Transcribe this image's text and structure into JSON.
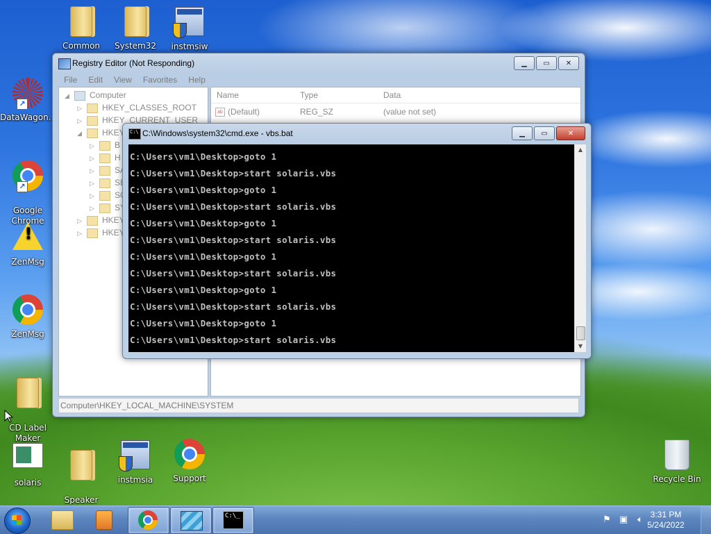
{
  "desktop_icons": [
    {
      "label": "Common",
      "icon": "folder-icon"
    },
    {
      "label": "System32",
      "icon": "folder-icon"
    },
    {
      "label": "instmsiw",
      "icon": "installer-icon"
    },
    {
      "label": "DataWagon...",
      "icon": "starburst-icon"
    },
    {
      "label": "Google\nChrome",
      "icon": "chrome-icon"
    },
    {
      "label": "ZenMsg",
      "icon": "warning-icon"
    },
    {
      "label": "ZenMsg",
      "icon": "chrome-icon"
    },
    {
      "label": "CD Label\nMaker",
      "icon": "folder-icon"
    },
    {
      "label": "solaris",
      "icon": "notepad-icon"
    },
    {
      "label": "Speaker\nEnhancement",
      "icon": "folder-icon"
    },
    {
      "label": "instmsia",
      "icon": "installer-icon"
    },
    {
      "label": "Support",
      "icon": "chrome-icon"
    },
    {
      "label": "Recycle Bin",
      "icon": "recycle-bin-icon"
    }
  ],
  "regedit": {
    "title": "Registry Editor (Not Responding)",
    "menu": [
      "File",
      "Edit",
      "View",
      "Favorites",
      "Help"
    ],
    "tree": {
      "root": "Computer",
      "items": [
        "HKEY_CLASSES_ROOT",
        "HKEY_CURRENT_USER",
        "HKEY",
        "B",
        "H",
        "SA",
        "SE",
        "SO",
        "SY",
        "HKEY",
        "HKEY"
      ]
    },
    "columns": [
      "Name",
      "Type",
      "Data"
    ],
    "rows": [
      {
        "name": "(Default)",
        "type": "REG_SZ",
        "data": "(value not set)"
      }
    ],
    "status": "Computer\\HKEY_LOCAL_MACHINE\\SYSTEM"
  },
  "cmd": {
    "title": "C:\\Windows\\system32\\cmd.exe - vbs.bat",
    "lines": [
      "C:\\Users\\vm1\\Desktop>goto 1",
      "C:\\Users\\vm1\\Desktop>start solaris.vbs",
      "C:\\Users\\vm1\\Desktop>goto 1",
      "C:\\Users\\vm1\\Desktop>start solaris.vbs",
      "C:\\Users\\vm1\\Desktop>goto 1",
      "C:\\Users\\vm1\\Desktop>start solaris.vbs",
      "C:\\Users\\vm1\\Desktop>goto 1",
      "C:\\Users\\vm1\\Desktop>start solaris.vbs",
      "C:\\Users\\vm1\\Desktop>goto 1",
      "C:\\Users\\vm1\\Desktop>start solaris.vbs",
      "C:\\Users\\vm1\\Desktop>goto 1",
      "C:\\Users\\vm1\\Desktop>start solaris.vbs"
    ]
  },
  "taskbar": {
    "items": [
      "explorer-icon",
      "media-player-icon",
      "chrome-icon",
      "registry-icon",
      "cmd-icon"
    ],
    "clock_time": "3:31 PM",
    "clock_date": "5/24/2022"
  }
}
